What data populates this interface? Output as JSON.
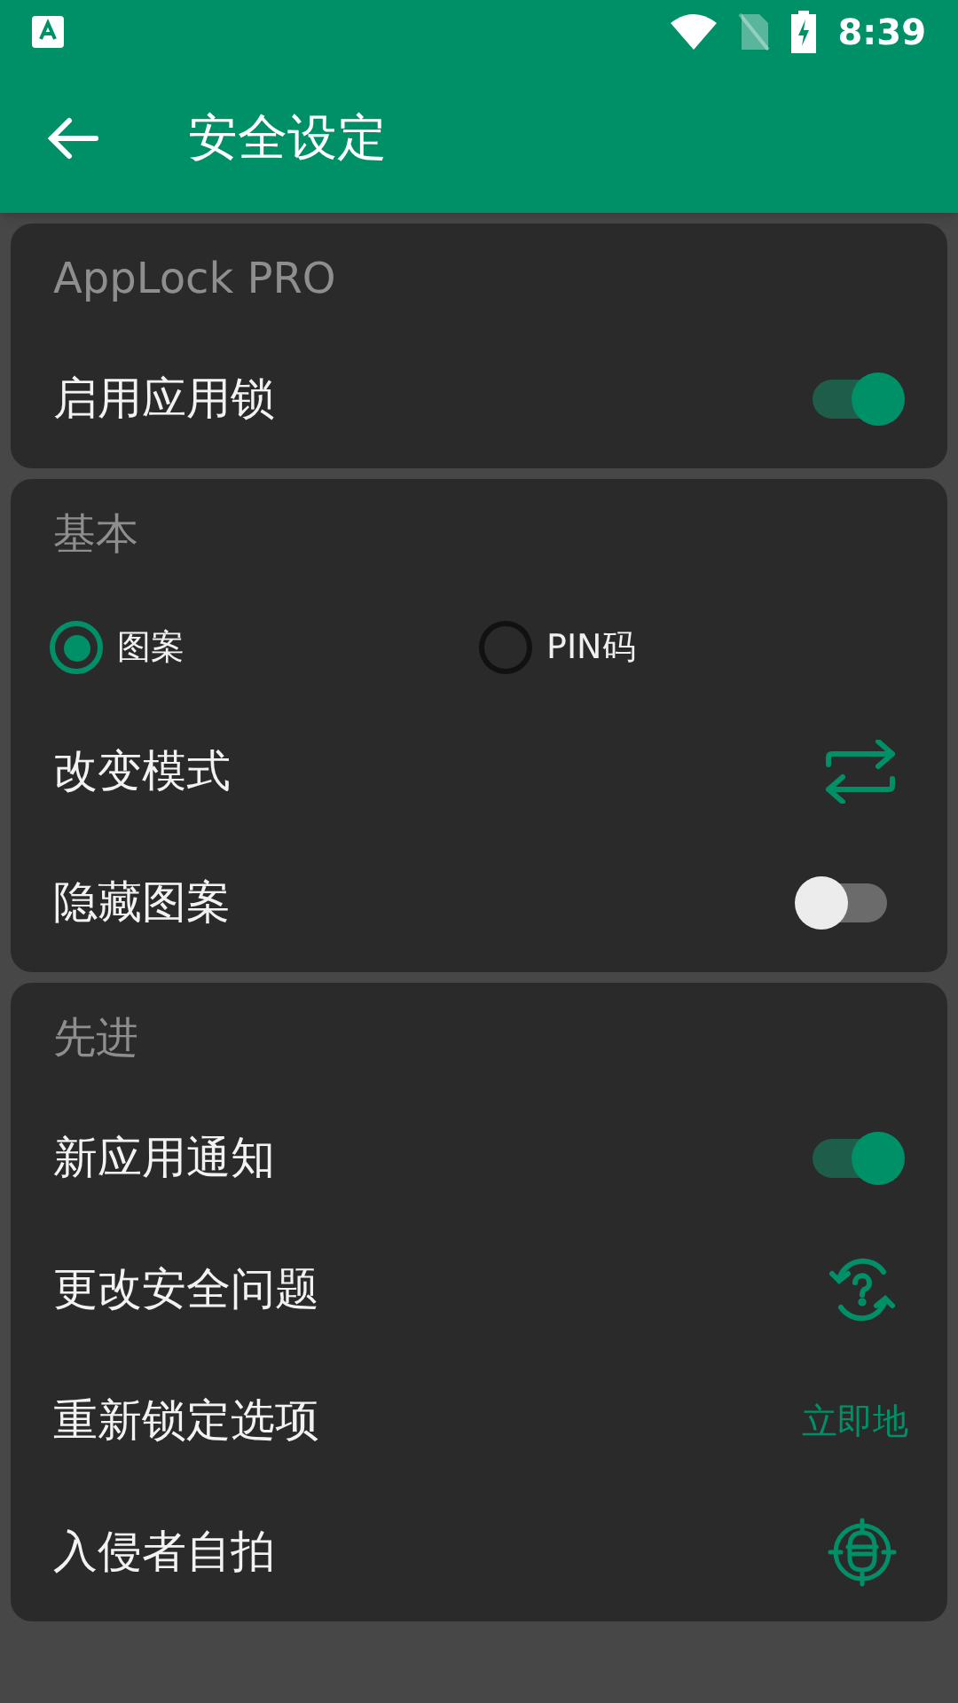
{
  "status_bar": {
    "time": "8:39"
  },
  "toolbar": {
    "title": "安全设定"
  },
  "sections": [
    {
      "title": "AppLock PRO",
      "rows": [
        {
          "kind": "toggle",
          "label": "启用应用锁",
          "on": true
        }
      ]
    },
    {
      "title": "基本",
      "rows": [
        {
          "kind": "choice",
          "options": [
            {
              "label": "图案",
              "selected": true
            },
            {
              "label": "PIN码",
              "selected": false
            }
          ]
        },
        {
          "kind": "swap",
          "label": "改变模式"
        },
        {
          "kind": "toggle",
          "label": "隐藏图案",
          "on": false
        }
      ]
    },
    {
      "title": "先进",
      "rows": [
        {
          "kind": "toggle",
          "label": "新应用通知",
          "on": true
        },
        {
          "kind": "question",
          "label": "更改安全问题"
        },
        {
          "kind": "value",
          "label": "重新锁定选项",
          "value": "立即地"
        },
        {
          "kind": "camera",
          "label": "入侵者自拍"
        }
      ]
    }
  ]
}
